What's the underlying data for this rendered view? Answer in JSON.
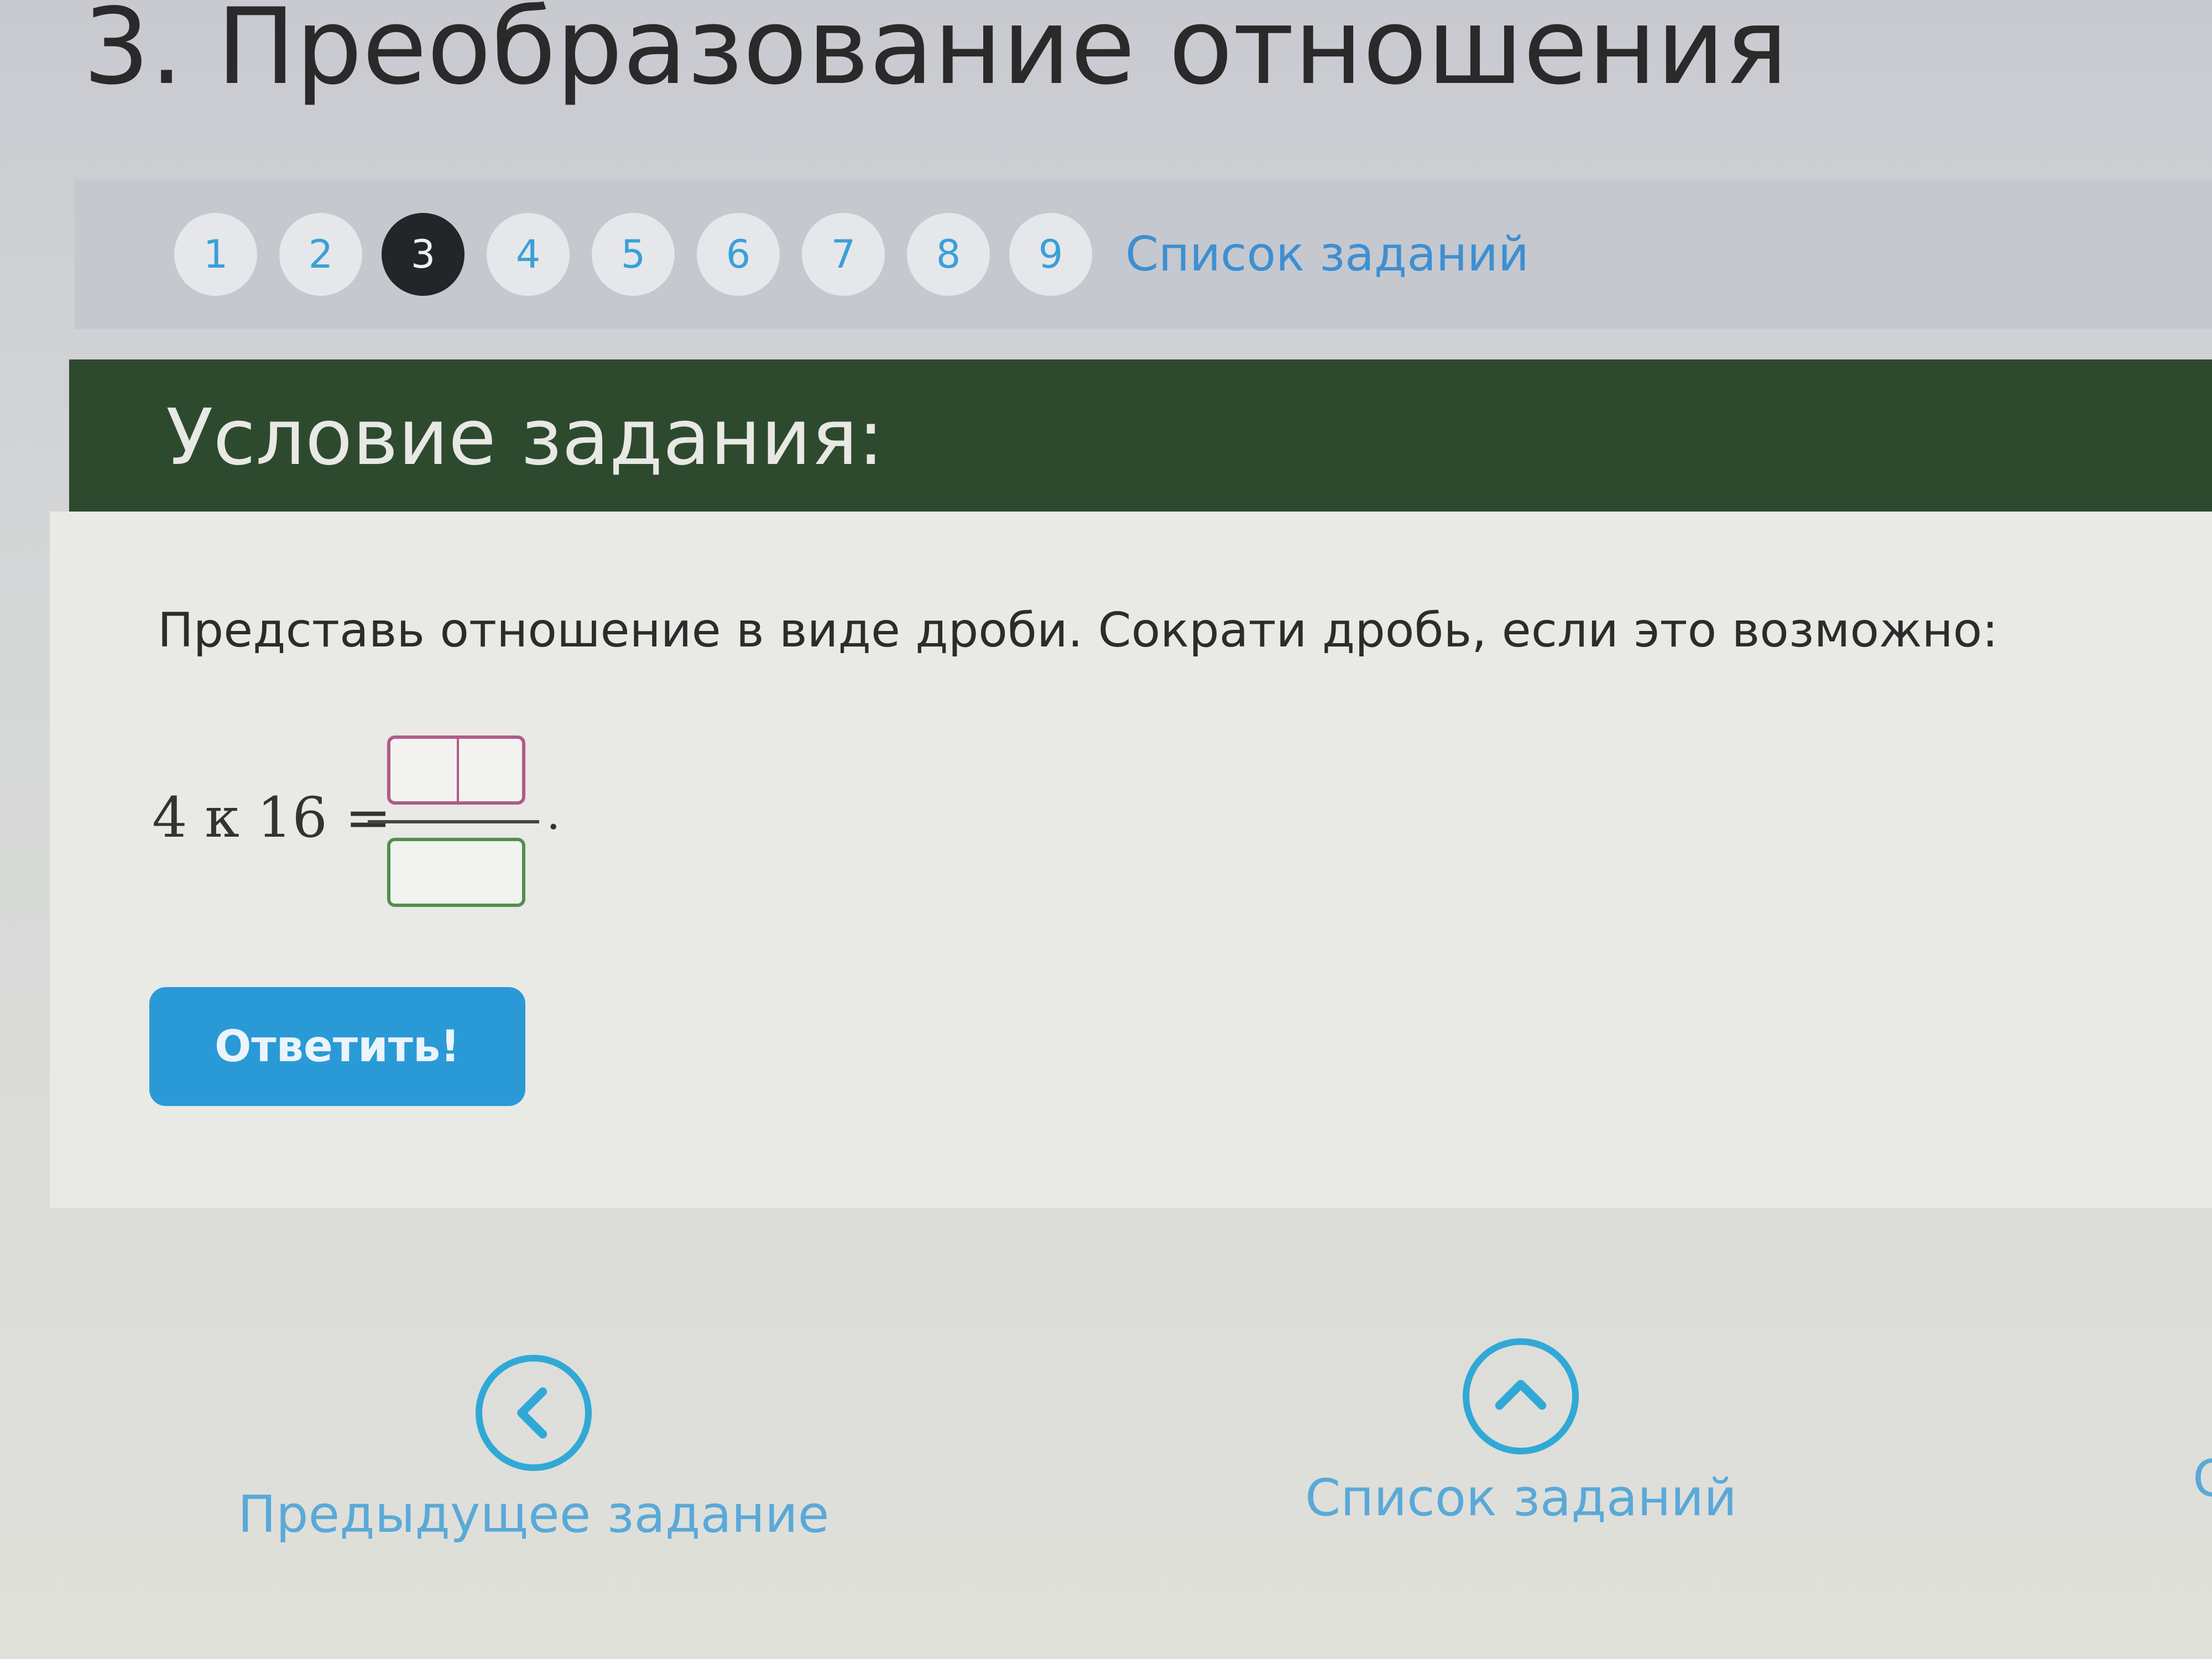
{
  "page": {
    "title": "3. Преобразование отношения"
  },
  "nav": {
    "steps": [
      "1",
      "2",
      "3",
      "4",
      "5",
      "6",
      "7",
      "8",
      "9"
    ],
    "active_step": "3",
    "task_list_label": "Список заданий"
  },
  "section": {
    "header": "Условие задания:"
  },
  "task": {
    "instruction": "Представь отношение в виде дроби. Сократи дробь, если это возможно:",
    "expression": "4 к 16 =",
    "trailing_punctuation": ".",
    "numerator_value": "",
    "denominator_value": ""
  },
  "answer_button": {
    "label": "Ответить!"
  },
  "bottom_nav": {
    "prev_label": "Предыдущее задание",
    "list_label": "Список заданий",
    "next_fragment": "С"
  },
  "colors": {
    "accent": "#2a9ad6",
    "header_bg": "#2e4a2e",
    "active_step_bg": "#232628",
    "link": "#3f8fd0",
    "numerator_border": "#b05a8a",
    "denominator_border": "#4f8f4f"
  },
  "icons": {
    "prev": "chevron-left-icon",
    "list": "chevron-up-icon"
  }
}
